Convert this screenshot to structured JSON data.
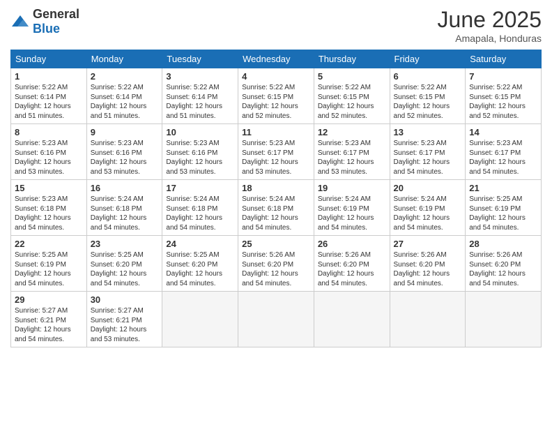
{
  "header": {
    "logo_general": "General",
    "logo_blue": "Blue",
    "month_title": "June 2025",
    "location": "Amapala, Honduras"
  },
  "weekdays": [
    "Sunday",
    "Monday",
    "Tuesday",
    "Wednesday",
    "Thursday",
    "Friday",
    "Saturday"
  ],
  "days": [
    null,
    null,
    null,
    {
      "day": 1,
      "sunrise": "5:22 AM",
      "sunset": "6:14 PM",
      "daylight": "12 hours and 51 minutes."
    },
    {
      "day": 2,
      "sunrise": "5:22 AM",
      "sunset": "6:14 PM",
      "daylight": "12 hours and 51 minutes."
    },
    {
      "day": 3,
      "sunrise": "5:22 AM",
      "sunset": "6:14 PM",
      "daylight": "12 hours and 51 minutes."
    },
    {
      "day": 4,
      "sunrise": "5:22 AM",
      "sunset": "6:15 PM",
      "daylight": "12 hours and 52 minutes."
    },
    {
      "day": 5,
      "sunrise": "5:22 AM",
      "sunset": "6:15 PM",
      "daylight": "12 hours and 52 minutes."
    },
    {
      "day": 6,
      "sunrise": "5:22 AM",
      "sunset": "6:15 PM",
      "daylight": "12 hours and 52 minutes."
    },
    {
      "day": 7,
      "sunrise": "5:22 AM",
      "sunset": "6:15 PM",
      "daylight": "12 hours and 52 minutes."
    },
    {
      "day": 8,
      "sunrise": "5:23 AM",
      "sunset": "6:16 PM",
      "daylight": "12 hours and 53 minutes."
    },
    {
      "day": 9,
      "sunrise": "5:23 AM",
      "sunset": "6:16 PM",
      "daylight": "12 hours and 53 minutes."
    },
    {
      "day": 10,
      "sunrise": "5:23 AM",
      "sunset": "6:16 PM",
      "daylight": "12 hours and 53 minutes."
    },
    {
      "day": 11,
      "sunrise": "5:23 AM",
      "sunset": "6:17 PM",
      "daylight": "12 hours and 53 minutes."
    },
    {
      "day": 12,
      "sunrise": "5:23 AM",
      "sunset": "6:17 PM",
      "daylight": "12 hours and 53 minutes."
    },
    {
      "day": 13,
      "sunrise": "5:23 AM",
      "sunset": "6:17 PM",
      "daylight": "12 hours and 54 minutes."
    },
    {
      "day": 14,
      "sunrise": "5:23 AM",
      "sunset": "6:17 PM",
      "daylight": "12 hours and 54 minutes."
    },
    {
      "day": 15,
      "sunrise": "5:23 AM",
      "sunset": "6:18 PM",
      "daylight": "12 hours and 54 minutes."
    },
    {
      "day": 16,
      "sunrise": "5:24 AM",
      "sunset": "6:18 PM",
      "daylight": "12 hours and 54 minutes."
    },
    {
      "day": 17,
      "sunrise": "5:24 AM",
      "sunset": "6:18 PM",
      "daylight": "12 hours and 54 minutes."
    },
    {
      "day": 18,
      "sunrise": "5:24 AM",
      "sunset": "6:18 PM",
      "daylight": "12 hours and 54 minutes."
    },
    {
      "day": 19,
      "sunrise": "5:24 AM",
      "sunset": "6:19 PM",
      "daylight": "12 hours and 54 minutes."
    },
    {
      "day": 20,
      "sunrise": "5:24 AM",
      "sunset": "6:19 PM",
      "daylight": "12 hours and 54 minutes."
    },
    {
      "day": 21,
      "sunrise": "5:25 AM",
      "sunset": "6:19 PM",
      "daylight": "12 hours and 54 minutes."
    },
    {
      "day": 22,
      "sunrise": "5:25 AM",
      "sunset": "6:19 PM",
      "daylight": "12 hours and 54 minutes."
    },
    {
      "day": 23,
      "sunrise": "5:25 AM",
      "sunset": "6:20 PM",
      "daylight": "12 hours and 54 minutes."
    },
    {
      "day": 24,
      "sunrise": "5:25 AM",
      "sunset": "6:20 PM",
      "daylight": "12 hours and 54 minutes."
    },
    {
      "day": 25,
      "sunrise": "5:26 AM",
      "sunset": "6:20 PM",
      "daylight": "12 hours and 54 minutes."
    },
    {
      "day": 26,
      "sunrise": "5:26 AM",
      "sunset": "6:20 PM",
      "daylight": "12 hours and 54 minutes."
    },
    {
      "day": 27,
      "sunrise": "5:26 AM",
      "sunset": "6:20 PM",
      "daylight": "12 hours and 54 minutes."
    },
    {
      "day": 28,
      "sunrise": "5:26 AM",
      "sunset": "6:20 PM",
      "daylight": "12 hours and 54 minutes."
    },
    {
      "day": 29,
      "sunrise": "5:27 AM",
      "sunset": "6:21 PM",
      "daylight": "12 hours and 54 minutes."
    },
    {
      "day": 30,
      "sunrise": "5:27 AM",
      "sunset": "6:21 PM",
      "daylight": "12 hours and 53 minutes."
    }
  ]
}
